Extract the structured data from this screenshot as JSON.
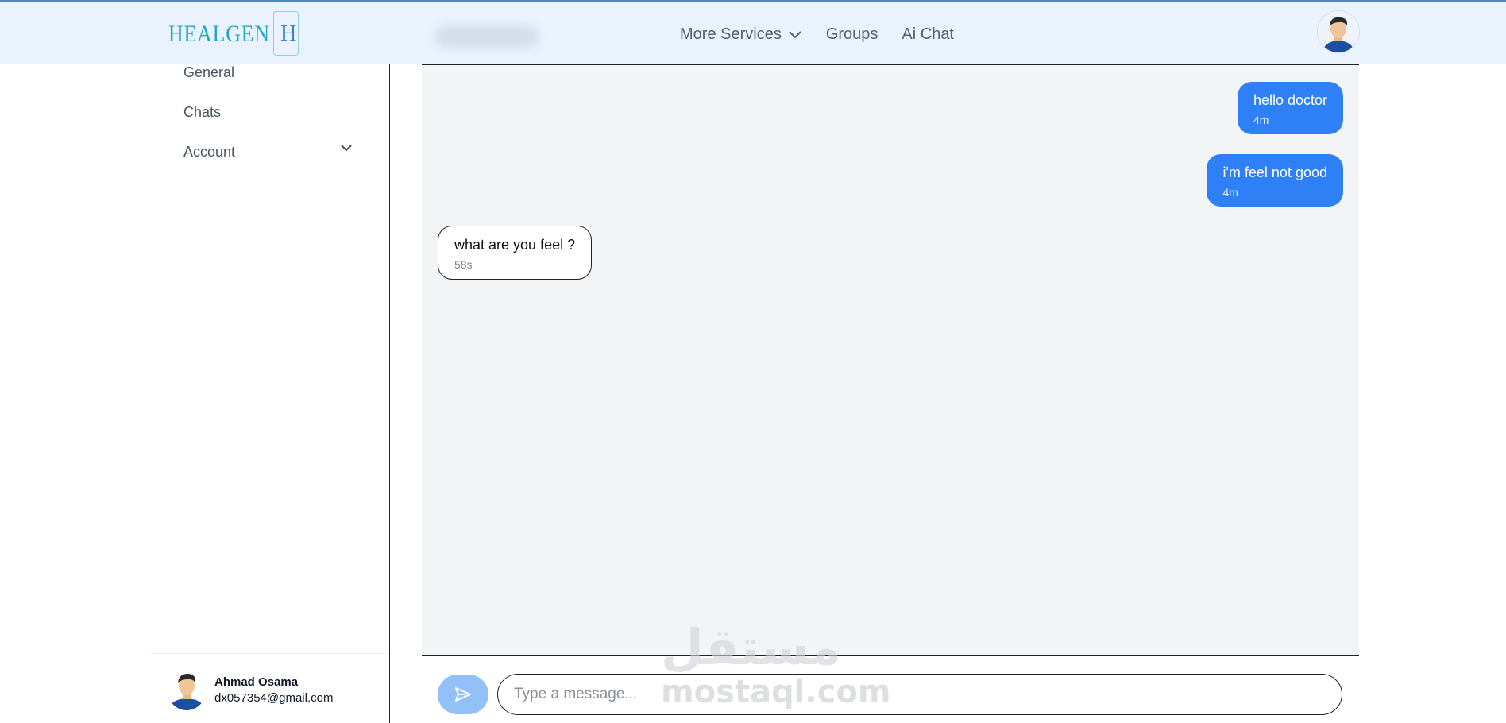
{
  "header": {
    "logo_text": "HEALGEN",
    "logo_mark": "H",
    "nav": [
      {
        "label": "More Services",
        "icon": "chevron-down-icon"
      },
      {
        "label": "Groups"
      },
      {
        "label": "Ai Chat"
      }
    ]
  },
  "sidebar": {
    "items": [
      {
        "label": "General"
      },
      {
        "label": "Chats"
      },
      {
        "label": "Account",
        "icon": "chevron-down-icon"
      }
    ],
    "profile": {
      "name": "Ahmad Osama",
      "email": "dx057354@gmail.com"
    }
  },
  "chat": {
    "messages": [
      {
        "direction": "out",
        "text": "hello doctor",
        "time": "4m"
      },
      {
        "direction": "out",
        "text": "i'm feel not good",
        "time": "4m"
      },
      {
        "direction": "in",
        "text": "what are you feel ?",
        "time": "58s"
      }
    ]
  },
  "composer": {
    "placeholder": "Type a message...",
    "send_icon": "send-icon"
  },
  "watermark": {
    "text": "mostaql.com",
    "arabic": "مستقل"
  },
  "colors": {
    "header_bg": "#eaf3fd",
    "accent": "#2f80f6",
    "send_button": "#93c0f7",
    "chat_bg": "#f3f4f6"
  }
}
